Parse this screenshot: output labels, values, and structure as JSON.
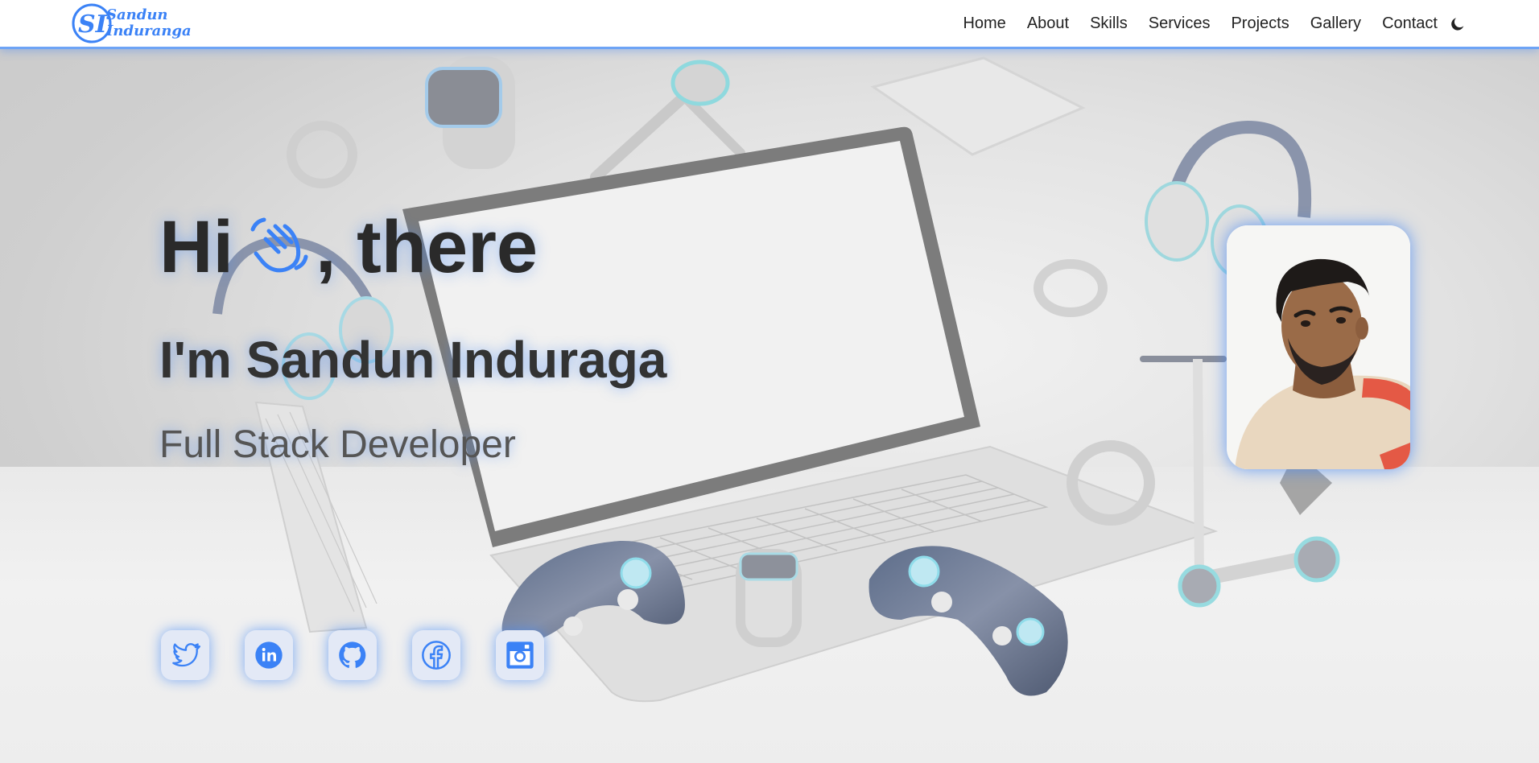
{
  "brand": {
    "name_line1": "Sandun",
    "name_line2": "Induranga",
    "accent": "#3b82f6"
  },
  "nav": {
    "items": [
      "Home",
      "About",
      "Skills",
      "Services",
      "Projects",
      "Gallery",
      "Contact"
    ],
    "theme_toggle_icon": "moon-icon"
  },
  "hero": {
    "greeting_before": "Hi",
    "greeting_icon": "waving-hand-icon",
    "greeting_after": ", there",
    "name_line": "I'm Sandun Induraga",
    "role": "Full Stack Developer"
  },
  "social": [
    {
      "icon": "twitter-icon"
    },
    {
      "icon": "linkedin-icon"
    },
    {
      "icon": "github-icon"
    },
    {
      "icon": "facebook-icon"
    },
    {
      "icon": "instagram-icon"
    }
  ],
  "profile": {
    "icon": "profile-photo"
  }
}
